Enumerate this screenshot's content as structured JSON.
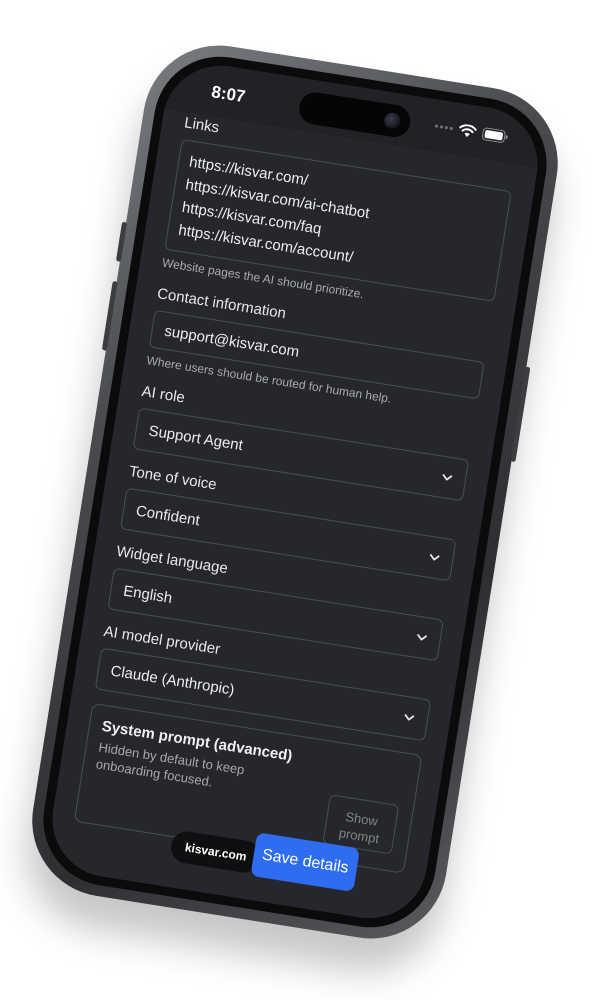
{
  "status_bar": {
    "time": "8:07"
  },
  "form": {
    "links": {
      "label": "Links",
      "lines": [
        "https://kisvar.com/",
        "https://kisvar.com/ai-chatbot",
        "https://kisvar.com/faq",
        "https://kisvar.com/account/"
      ],
      "hint": "Website pages the AI should prioritize."
    },
    "contact": {
      "label": "Contact information",
      "value": "support@kisvar.com",
      "hint": "Where users should be routed for human help."
    },
    "ai_role": {
      "label": "AI role",
      "value": "Support Agent"
    },
    "tone": {
      "label": "Tone of voice",
      "value": "Confident"
    },
    "language": {
      "label": "Widget language",
      "value": "English"
    },
    "provider": {
      "label": "AI model provider",
      "value": "Claude (Anthropic)"
    },
    "system_prompt": {
      "title": "System prompt (advanced)",
      "description": "Hidden by default to keep onboarding focused.",
      "button_line1": "Show",
      "button_line2": "prompt"
    }
  },
  "bottom_bar": {
    "domain": "kisvar.com",
    "save_label": "Save details"
  },
  "colors": {
    "accent": "#2f6df0",
    "screen_bg": "#25272c",
    "border": "#4a4d54"
  },
  "icons": {
    "status": [
      "wifi-icon",
      "battery-icon",
      "signal-icon"
    ],
    "select": "chevron-down-icon"
  }
}
